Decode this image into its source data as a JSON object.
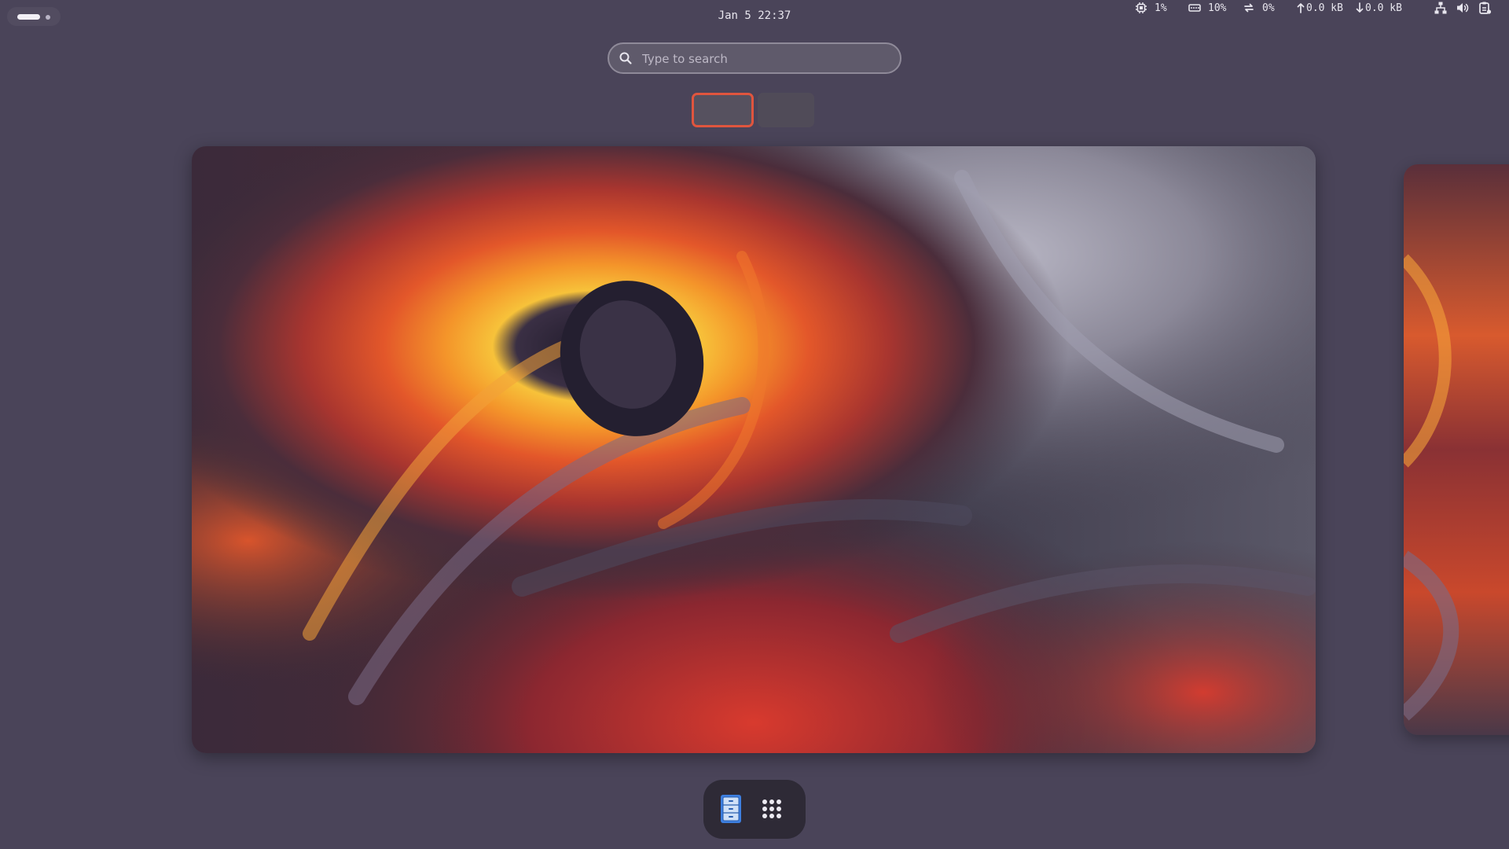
{
  "topbar": {
    "activities_icon": "activities-indicator",
    "clock": "Jan 5 22:37",
    "indicators": {
      "cpu": {
        "icon": "cpu-icon",
        "value": "1%"
      },
      "memory": {
        "icon": "memory-icon",
        "value": "10%"
      },
      "swap": {
        "icon": "swap-icon",
        "value": "0%"
      },
      "upload": {
        "icon": "arrow-up-icon",
        "value": "0.0 kB"
      },
      "download": {
        "icon": "arrow-down-icon",
        "value": "0.0 kB"
      }
    },
    "tray_icons": [
      "network-icon",
      "volume-icon",
      "clipboard-icon"
    ]
  },
  "search": {
    "icon": "search-icon",
    "placeholder": "Type to search"
  },
  "workspaces": {
    "active_index": 0,
    "accent_color": "#e0553e"
  },
  "dock": {
    "items": [
      {
        "name": "files",
        "icon": "files-icon",
        "accent_color": "#3d7fe0"
      },
      {
        "name": "show-apps",
        "icon": "app-grid-icon"
      }
    ]
  },
  "colors": {
    "background": "#4a4459",
    "dock_background": "#2e2a36",
    "search_background": "#5f5a6b"
  }
}
